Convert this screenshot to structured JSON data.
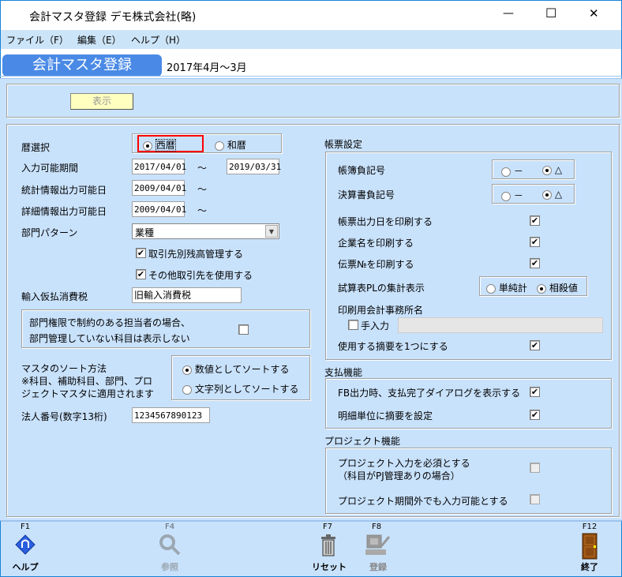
{
  "window": {
    "title": "会計マスタ登録 デモ株式会社(略)",
    "minimize": "—",
    "maximize": "☐",
    "close": "✕"
  },
  "menu": [
    "ファイル（F）",
    "編集（E）",
    "ヘルプ（H）"
  ],
  "header": {
    "tab": "会計マスタ登録",
    "period": "2017年4月～3月"
  },
  "show_button": "表示",
  "left": {
    "calendar_label": "暦選択",
    "calendar_options": [
      "西暦",
      "和暦"
    ],
    "calendar_selected": "西暦",
    "input_period_label": "入力可能期間",
    "input_period_from": "2017/04/01",
    "input_period_to": "2019/03/31",
    "tilde": "～",
    "stats_label": "統計情報出力可能日",
    "stats_from": "2009/04/01",
    "detail_label": "詳細情報出力可能日",
    "detail_from": "2009/04/01",
    "dept_pattern_label": "部門パターン",
    "dept_pattern_value": "業種",
    "chk_balance": {
      "label": "取引先別残高管理する",
      "checked": true
    },
    "chk_other": {
      "label": "その他取引先を使用する",
      "checked": true
    },
    "import_tax_label": "輸入仮払消費税",
    "import_tax_value": "旧輸入消費税",
    "dept_restrict": {
      "line1": "部門権限で制約のある担当者の場合、",
      "line2": "部門管理していない科目は表示しない",
      "checked": false
    },
    "sort": {
      "line1": "マスタのソート方法",
      "line2": "※科目、補助科目、部門、プロ",
      "line3": "ジェクトマスタに適用されます",
      "options": [
        "数値としてソートする",
        "文字列としてソートする"
      ],
      "selected": "数値としてソートする"
    },
    "corp_no_label": "法人番号(数字13桁)",
    "corp_no_value": "1234567890123"
  },
  "right": {
    "report_title": "帳票設定",
    "ledger_neg_label": "帳簿負記号",
    "neg_options": [
      "－",
      "△"
    ],
    "ledger_neg_selected": "△",
    "fs_neg_label": "決算書負記号",
    "fs_neg_selected": "△",
    "print_date": {
      "label": "帳票出力日を印刷する",
      "checked": true
    },
    "print_company": {
      "label": "企業名を印刷する",
      "checked": true
    },
    "print_slip": {
      "label": "伝票№を印刷する",
      "checked": true
    },
    "pl_label": "試算表PLの集計表示",
    "pl_options": [
      "単純計",
      "相殺値"
    ],
    "pl_selected": "相殺値",
    "office_label": "印刷用会計事務所名",
    "manual_label": "手入力",
    "manual_checked": false,
    "office_value": "",
    "one_summary": {
      "label": "使用する摘要を1つにする",
      "checked": true
    },
    "pay_title": "支払機能",
    "fb_dialog": {
      "label": "FB出力時、支払完了ダイアログを表示する",
      "checked": true
    },
    "detail_summary": {
      "label": "明細単位に摘要を設定",
      "checked": true
    },
    "proj_title": "プロジェクト機能",
    "proj_required": {
      "line1": "プロジェクト入力を必須とする",
      "line2": "（科目がPJ管理ありの場合）",
      "checked": false
    },
    "proj_outside": {
      "label": "プロジェクト期間外でも入力可能とする",
      "checked": false
    }
  },
  "footer": [
    {
      "key": "F1",
      "label": "ヘルプ",
      "icon": "help-book-icon",
      "enabled": true
    },
    {
      "key": "F4",
      "label": "参照",
      "icon": "magnifier-icon",
      "enabled": false
    },
    {
      "key": "F7",
      "label": "リセット",
      "icon": "trash-icon",
      "enabled": true
    },
    {
      "key": "F8",
      "label": "登録",
      "icon": "computer-register-icon",
      "enabled": false
    },
    {
      "key": "F12",
      "label": "終了",
      "icon": "door-exit-icon",
      "enabled": true
    }
  ],
  "colors": {
    "accent": "#4a8ae6",
    "background": "#c9e2fc",
    "highlight": "#ff0000",
    "button": "#ffffc0"
  }
}
